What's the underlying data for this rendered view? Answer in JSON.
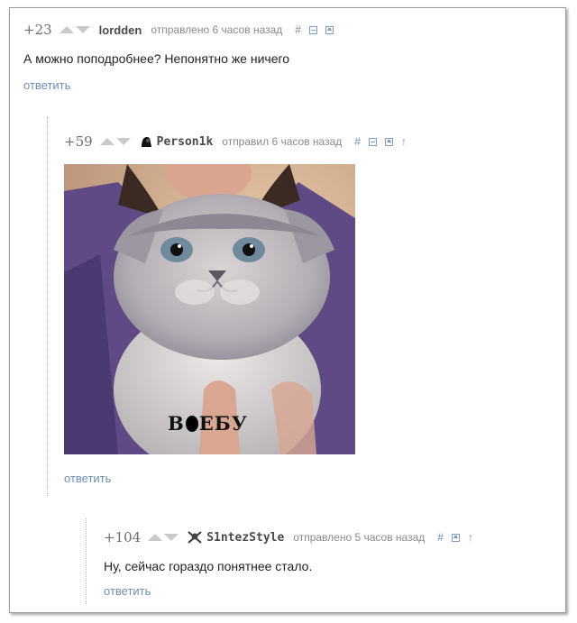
{
  "comments": [
    {
      "rating": "+23",
      "author": "lordden",
      "status": "отправлено 6 часов назад",
      "text": "А можно поподробнее? Непонятно же ничего",
      "reply": "ответить"
    },
    {
      "rating": "+59",
      "author": "Person1k",
      "status": "отправил 6 часов назад",
      "image_caption_before": "В",
      "image_caption_after": "ЕБУ",
      "reply": "ответить"
    },
    {
      "rating": "+104",
      "author": "S1ntezStyle",
      "status": "отправлено 5 часов назад",
      "text": "Ну, сейчас гораздо понятнее стало.",
      "reply": "ответить"
    }
  ],
  "icons": {
    "link": "#",
    "up": "↑"
  },
  "colors": {
    "link": "#6e8fb6",
    "text": "#222222",
    "meta": "#8a8a8a"
  }
}
